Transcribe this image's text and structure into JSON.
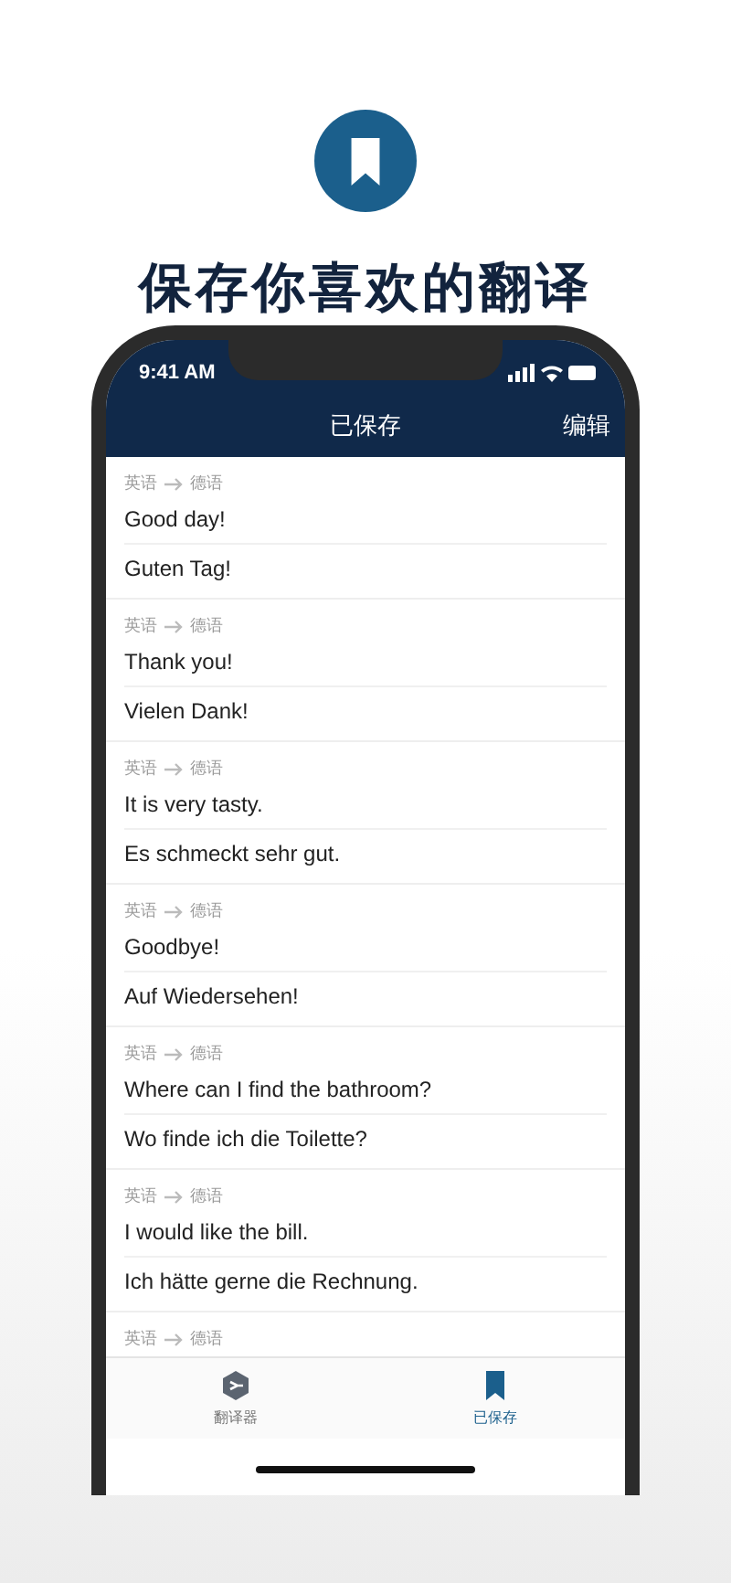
{
  "promo": {
    "heading": "保存你喜欢的翻译"
  },
  "status_bar": {
    "time": "9:41 AM"
  },
  "nav": {
    "title": "已保存",
    "edit": "编辑"
  },
  "items": [
    {
      "from": "英语",
      "to": "德语",
      "source": "Good day!",
      "target": "Guten Tag!"
    },
    {
      "from": "英语",
      "to": "德语",
      "source": "Thank you!",
      "target": "Vielen Dank!"
    },
    {
      "from": "英语",
      "to": "德语",
      "source": "It is very tasty.",
      "target": "Es schmeckt sehr gut."
    },
    {
      "from": "英语",
      "to": "德语",
      "source": "Goodbye!",
      "target": "Auf Wiedersehen!"
    },
    {
      "from": "英语",
      "to": "德语",
      "source": "Where can I find the bathroom?",
      "target": "Wo finde ich die Toilette?"
    },
    {
      "from": "英语",
      "to": "德语",
      "source": "I would like the bill.",
      "target": "Ich hätte gerne die Rechnung."
    },
    {
      "from": "英语",
      "to": "德语"
    }
  ],
  "tabs": [
    {
      "label": "翻译器",
      "kind": "translator",
      "selected": false
    },
    {
      "label": "已保存",
      "kind": "saved",
      "selected": true
    }
  ]
}
